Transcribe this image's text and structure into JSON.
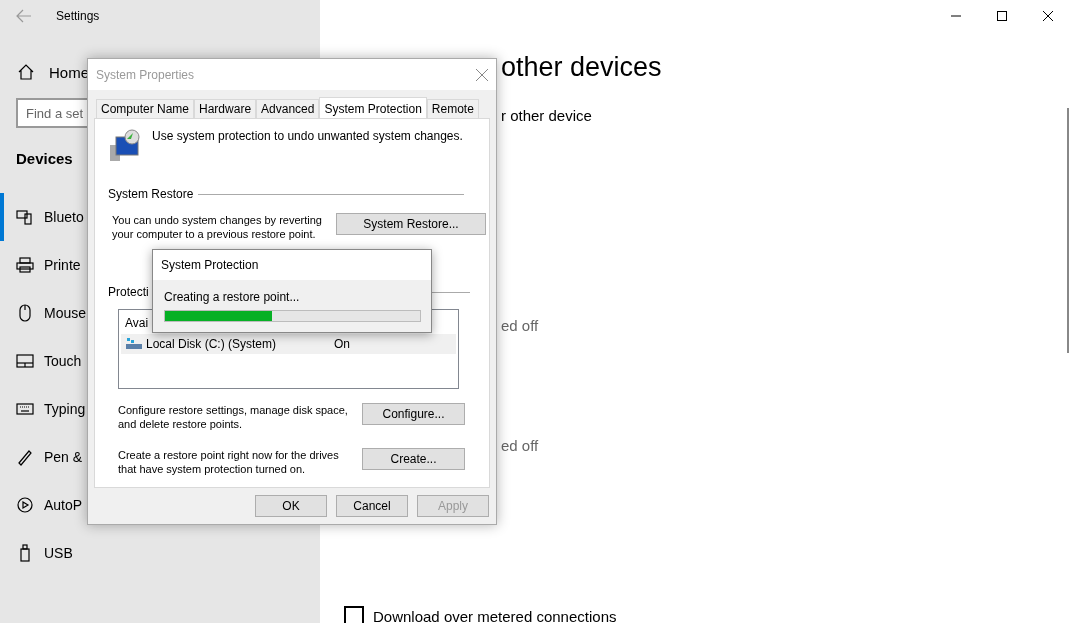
{
  "settings": {
    "title": "Settings",
    "home": "Home",
    "search": {
      "placeholder": "Find a set"
    },
    "section": "Devices",
    "items": [
      {
        "label": "Blueto",
        "selected": true
      },
      {
        "label": "Printe",
        "selected": false
      },
      {
        "label": "Mouse",
        "selected": false
      },
      {
        "label": "Touch",
        "selected": false
      },
      {
        "label": "Typing",
        "selected": false
      },
      {
        "label": "Pen &",
        "selected": false
      },
      {
        "label": "AutoP",
        "selected": false
      },
      {
        "label": "USB",
        "selected": false
      }
    ],
    "heading": "other devices",
    "link": "r other device",
    "status_1": "ed off",
    "status_2": "ed off",
    "metered": {
      "label": "Download over metered connections",
      "checked": false
    }
  },
  "system_properties": {
    "title": "System Properties",
    "tabs": [
      {
        "label": "Computer Name",
        "selected": false
      },
      {
        "label": "Hardware",
        "selected": false
      },
      {
        "label": "Advanced",
        "selected": false
      },
      {
        "label": "System Protection",
        "selected": true
      },
      {
        "label": "Remote",
        "selected": false
      }
    ],
    "intro": "Use system protection to undo unwanted system changes.",
    "restore_group": "System Restore",
    "restore_text": "You can undo system changes by reverting your computer to a previous restore point.",
    "restore_button": "System Restore...",
    "protection_group": "Protecti",
    "list_header": "Avai",
    "drives": [
      {
        "name": "Local Disk (C:) (System)",
        "protection": "On",
        "selected": true
      }
    ],
    "configure_text": "Configure restore settings, manage disk space, and delete restore points.",
    "configure_button": "Configure...",
    "create_text": "Create a restore point right now for the drives that have system protection turned on.",
    "create_button": "Create...",
    "buttons": [
      {
        "label": "OK",
        "disabled": false
      },
      {
        "label": "Cancel",
        "disabled": false
      },
      {
        "label": "Apply",
        "disabled": true
      }
    ]
  },
  "progress_dialog": {
    "title": "System Protection",
    "message": "Creating a restore point...",
    "level": 0.42
  }
}
